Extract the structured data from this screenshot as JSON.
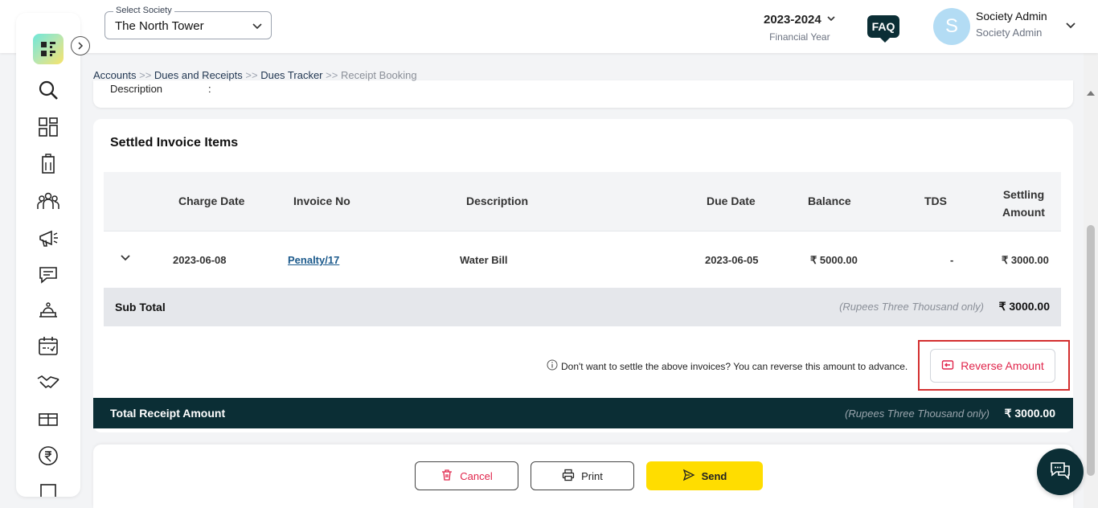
{
  "header": {
    "society_label": "Select Society",
    "society_value": "The North Tower",
    "financial_year": "2023-2024",
    "financial_year_label": "Financial Year",
    "faq_label": "FAQ",
    "avatar_letter": "S",
    "user_name": "Society Admin",
    "user_role": "Society Admin"
  },
  "breadcrumb": {
    "items": [
      "Accounts",
      "Dues and Receipts",
      "Dues Tracker"
    ],
    "separator": ">>",
    "current": "Receipt Booking"
  },
  "top_card": {
    "description_label": "Description",
    "colon": ":"
  },
  "settled": {
    "title": "Settled Invoice Items",
    "columns": [
      "Charge Date",
      "Invoice No",
      "Description",
      "Due Date",
      "Balance",
      "TDS",
      "Settling",
      "Amount"
    ],
    "rows": [
      {
        "charge_date": "2023-06-08",
        "invoice_no": "Penalty/17",
        "description": "Water Bill",
        "due_date": "2023-06-05",
        "balance": "₹ 5000.00",
        "tds": "-",
        "settling_amount": "₹ 3000.00"
      }
    ],
    "subtotal_label": "Sub Total",
    "subtotal_words": "(Rupees Three Thousand only)",
    "subtotal_amount": "₹ 3000.00",
    "reverse_note": "Don't want to settle the above invoices? You can reverse this amount to advance.",
    "reverse_button": "Reverse Amount"
  },
  "total": {
    "label": "Total Receipt Amount",
    "words": "(Rupees Three Thousand only)",
    "amount": "₹ 3000.00"
  },
  "footer": {
    "cancel": "Cancel",
    "print": "Print",
    "send": "Send"
  },
  "colors": {
    "brand_dark": "#0b2e35",
    "accent_yellow": "#ffdd00",
    "danger": "#e0254b",
    "highlight_border": "#d32f2f"
  },
  "sidebar_icons": [
    "search-icon",
    "dashboard-icon",
    "building-icon",
    "members-icon",
    "megaphone-icon",
    "chat-icon",
    "service-icon",
    "calendar-icon",
    "handshake-icon",
    "package-icon",
    "rupee-icon"
  ]
}
